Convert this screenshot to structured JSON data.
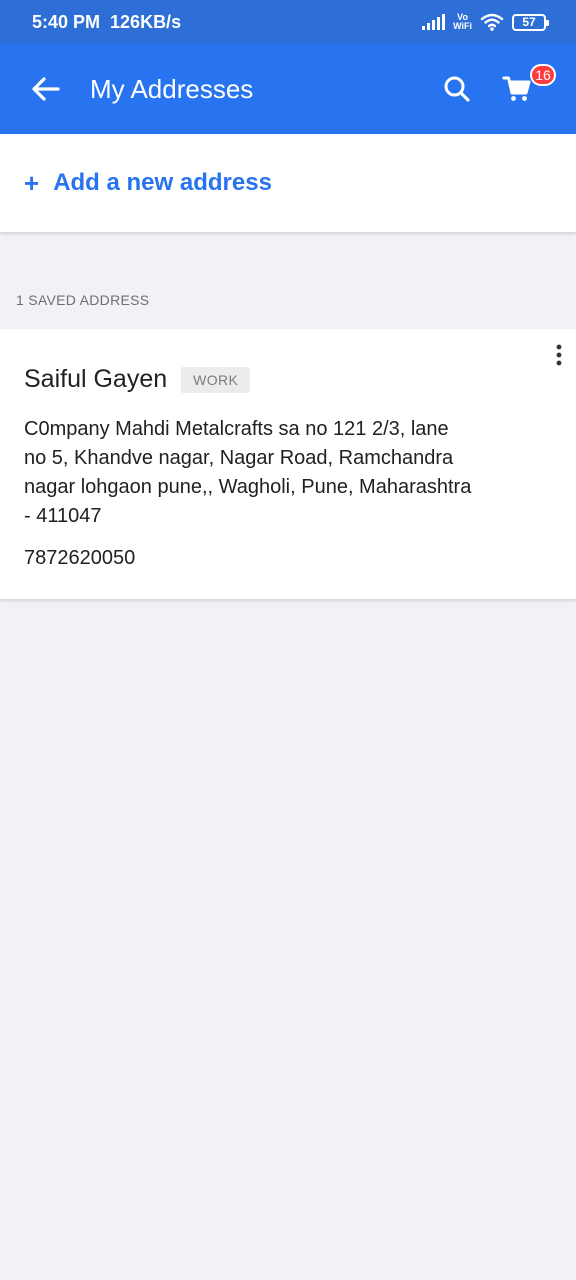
{
  "status_bar": {
    "time": "5:40 PM",
    "speed": "126KB/s",
    "vowifi_top": "Vo",
    "vowifi_bottom": "WiFi",
    "battery": "57"
  },
  "app_bar": {
    "title": "My Addresses",
    "cart_count": "16",
    "icons": [
      "back-arrow-icon",
      "search-icon",
      "cart-icon"
    ]
  },
  "add_address": {
    "plus": "+",
    "label": "Add a new address"
  },
  "saved_section": {
    "label": "1 SAVED ADDRESS"
  },
  "addresses": [
    {
      "name": "Saiful Gayen",
      "tag": "WORK",
      "address": "C0mpany Mahdi Metalcrafts sa no 121 2/3, lane no 5, Khandve nagar, Nagar Road, Ramchandra nagar lohgaon pune,, Wagholi, Pune, Maharashtra - 411047",
      "phone": "7872620050"
    }
  ],
  "colors": {
    "primary": "#2874f0",
    "status_bar": "#2d6fd6",
    "badge": "#ff3b3b",
    "background": "#f1f2f6"
  }
}
